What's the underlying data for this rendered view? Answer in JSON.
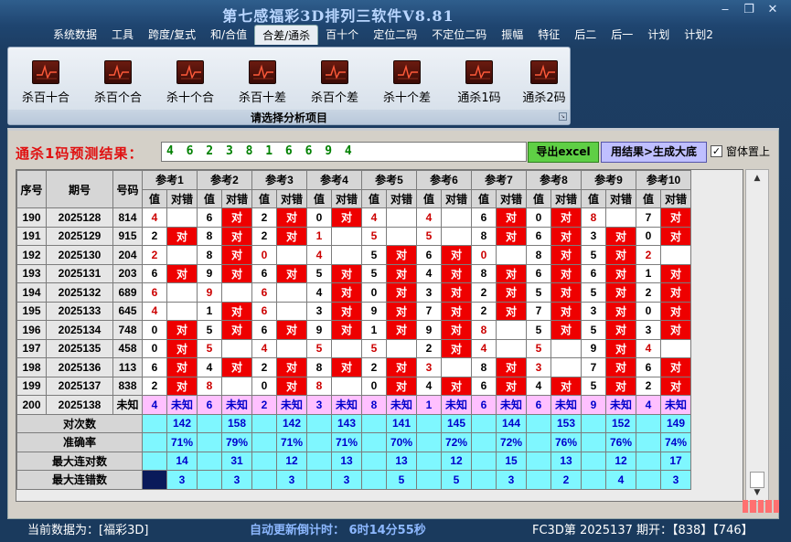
{
  "window": {
    "title": "第七感福彩3D排列三软件V8.81"
  },
  "menu": [
    "系统数据",
    "工具",
    "跨度/复式",
    "和/合值",
    "合差/通杀",
    "百十个",
    "定位二码",
    "不定位二码",
    "振幅",
    "特征",
    "后二",
    "后一",
    "计划",
    "计划2"
  ],
  "menu_active": "合差/通杀",
  "ribbon": {
    "buttons": [
      "杀百十合",
      "杀百个合",
      "杀十个合",
      "杀百十差",
      "杀百个差",
      "杀十个差",
      "通杀1码",
      "通杀2码"
    ],
    "caption": "请选择分析项目"
  },
  "prediction": {
    "label": "通杀1码预测结果：",
    "value": "4 6 2 3 8 1 6 6 9 4",
    "export_btn": "导出excel",
    "big_btn": "用结果>生成大底",
    "ontop_label": "窗体置上",
    "ontop_checked": true
  },
  "table": {
    "headers": [
      "序号",
      "期号",
      "号码"
    ],
    "refs": [
      "参考1",
      "参考2",
      "参考3",
      "参考4",
      "参考5",
      "参考6",
      "参考7",
      "参考8",
      "参考9",
      "参考10"
    ],
    "sub": [
      "值",
      "对错"
    ],
    "rows": [
      {
        "idx": "190",
        "period": "2025128",
        "num": "814",
        "vals": [
          "4",
          "6",
          "2",
          "0",
          "4",
          "4",
          "6",
          "0",
          "8",
          "7"
        ],
        "res": [
          "",
          "对",
          "对",
          "对",
          "",
          "",
          "对",
          "对",
          "",
          "对"
        ]
      },
      {
        "idx": "191",
        "period": "2025129",
        "num": "915",
        "vals": [
          "2",
          "8",
          "2",
          "1",
          "5",
          "5",
          "8",
          "6",
          "3",
          "0"
        ],
        "res": [
          "对",
          "对",
          "对",
          "",
          "",
          "",
          "对",
          "对",
          "对",
          "对"
        ]
      },
      {
        "idx": "192",
        "period": "2025130",
        "num": "204",
        "vals": [
          "2",
          "8",
          "0",
          "4",
          "5",
          "6",
          "0",
          "8",
          "5",
          "2"
        ],
        "res": [
          "",
          "对",
          "",
          "",
          "对",
          "对",
          "",
          "对",
          "对",
          ""
        ]
      },
      {
        "idx": "193",
        "period": "2025131",
        "num": "203",
        "vals": [
          "6",
          "9",
          "6",
          "5",
          "5",
          "4",
          "8",
          "6",
          "6",
          "1"
        ],
        "res": [
          "对",
          "对",
          "对",
          "对",
          "对",
          "对",
          "对",
          "对",
          "对",
          "对"
        ]
      },
      {
        "idx": "194",
        "period": "2025132",
        "num": "689",
        "vals": [
          "6",
          "9",
          "6",
          "4",
          "0",
          "3",
          "2",
          "5",
          "5",
          "2"
        ],
        "res": [
          "",
          "",
          "",
          "对",
          "对",
          "对",
          "对",
          "对",
          "对",
          "对"
        ]
      },
      {
        "idx": "195",
        "period": "2025133",
        "num": "645",
        "vals": [
          "4",
          "1",
          "6",
          "3",
          "9",
          "7",
          "2",
          "7",
          "3",
          "0"
        ],
        "res": [
          "",
          "对",
          "",
          "对",
          "对",
          "对",
          "对",
          "对",
          "对",
          "对"
        ]
      },
      {
        "idx": "196",
        "period": "2025134",
        "num": "748",
        "vals": [
          "0",
          "5",
          "6",
          "9",
          "1",
          "9",
          "8",
          "5",
          "5",
          "3"
        ],
        "res": [
          "对",
          "对",
          "对",
          "对",
          "对",
          "对",
          "",
          "对",
          "对",
          "对"
        ]
      },
      {
        "idx": "197",
        "period": "2025135",
        "num": "458",
        "vals": [
          "0",
          "5",
          "4",
          "5",
          "5",
          "2",
          "4",
          "5",
          "9",
          "4"
        ],
        "res": [
          "对",
          "",
          "",
          "",
          "",
          "对",
          "",
          "",
          "对",
          ""
        ]
      },
      {
        "idx": "198",
        "period": "2025136",
        "num": "113",
        "vals": [
          "6",
          "4",
          "2",
          "8",
          "2",
          "3",
          "8",
          "3",
          "7",
          "6"
        ],
        "res": [
          "对",
          "对",
          "对",
          "对",
          "对",
          "",
          "对",
          "",
          "对",
          "对"
        ]
      },
      {
        "idx": "199",
        "period": "2025137",
        "num": "838",
        "vals": [
          "2",
          "8",
          "0",
          "8",
          "0",
          "4",
          "6",
          "4",
          "5",
          "2"
        ],
        "res": [
          "对",
          "",
          "对",
          "",
          "对",
          "对",
          "对",
          "对",
          "对",
          "对"
        ]
      }
    ],
    "pending": {
      "idx": "200",
      "period": "2025138",
      "num": "未知",
      "vals": [
        "4",
        "6",
        "2",
        "3",
        "8",
        "1",
        "6",
        "6",
        "9",
        "4"
      ],
      "res": "未知"
    },
    "stats": [
      {
        "label": "对次数",
        "vals": [
          "142",
          "158",
          "142",
          "143",
          "141",
          "145",
          "144",
          "153",
          "152",
          "149"
        ]
      },
      {
        "label": "准确率",
        "vals": [
          "71%",
          "79%",
          "71%",
          "71%",
          "70%",
          "72%",
          "72%",
          "76%",
          "76%",
          "74%"
        ]
      },
      {
        "label": "最大连对数",
        "vals": [
          "14",
          "31",
          "12",
          "13",
          "13",
          "12",
          "15",
          "13",
          "12",
          "17"
        ]
      },
      {
        "label": "最大连错数",
        "vals": [
          "3",
          "3",
          "3",
          "3",
          "5",
          "5",
          "3",
          "2",
          "4",
          "3"
        ]
      }
    ]
  },
  "status": {
    "current": "当前数据为：[福彩3D]",
    "countdown": "自动更新倒计时： 6时14分55秒",
    "latest": "FC3D第 2025137 期开：【838】【746】"
  },
  "colors": {
    "miss": "#ee0000",
    "pending": "#ffc0ff",
    "stat": "#7ff7ff",
    "accent": "#e01010"
  }
}
